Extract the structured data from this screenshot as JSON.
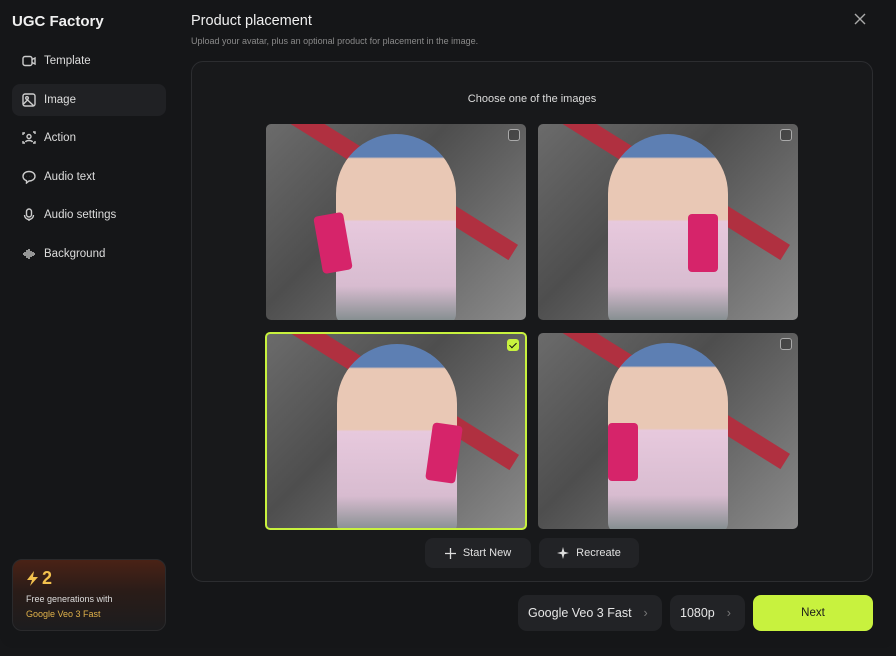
{
  "brand": "UGC Factory",
  "nav": [
    {
      "label": "Template",
      "icon": "template-icon"
    },
    {
      "label": "Image",
      "icon": "image-icon",
      "active": true
    },
    {
      "label": "Action",
      "icon": "action-icon"
    },
    {
      "label": "Audio text",
      "icon": "chat-icon"
    },
    {
      "label": "Audio settings",
      "icon": "microphone-icon"
    },
    {
      "label": "Background",
      "icon": "waveform-icon"
    }
  ],
  "promo": {
    "count": "2",
    "line1": "Free generations with",
    "line2": "Google Veo 3 Fast"
  },
  "header": {
    "title": "Product placement",
    "subtitle": "Upload your avatar, plus an optional product for placement in the image."
  },
  "panel": {
    "prompt": "Choose one of the images",
    "selected_index": 2,
    "start_new": "Start New",
    "recreate": "Recreate"
  },
  "footer": {
    "model": "Google Veo 3 Fast",
    "resolution": "1080p",
    "next": "Next"
  },
  "colors": {
    "accent": "#c8f23e",
    "promo_text": "#e0b24a"
  }
}
